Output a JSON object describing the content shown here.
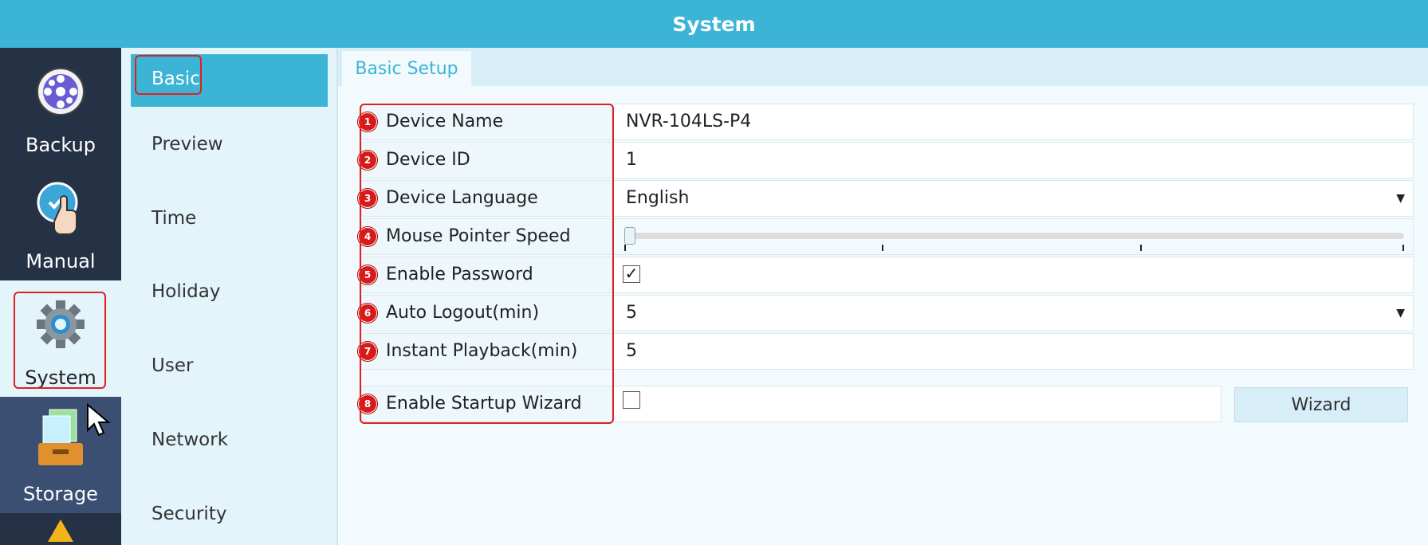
{
  "window": {
    "title": "System"
  },
  "modules": [
    {
      "label": "Backup",
      "icon": "film-reel-icon"
    },
    {
      "label": "Manual",
      "icon": "hand-pointer-icon"
    },
    {
      "label": "System",
      "icon": "gear-icon"
    },
    {
      "label": "Storage",
      "icon": "folder-stack-icon"
    },
    {
      "label": "",
      "icon": "alarm-warning-icon"
    }
  ],
  "submenu": {
    "items": [
      {
        "label": "Basic"
      },
      {
        "label": "Preview"
      },
      {
        "label": "Time"
      },
      {
        "label": "Holiday"
      },
      {
        "label": "User"
      },
      {
        "label": "Network"
      },
      {
        "label": "Security"
      }
    ]
  },
  "tabs": [
    {
      "label": "Basic Setup"
    }
  ],
  "form": {
    "device_name": {
      "badge": "1",
      "label": "Device Name",
      "value": "NVR-104LS-P4"
    },
    "device_id": {
      "badge": "2",
      "label": "Device ID",
      "value": "1"
    },
    "device_language": {
      "badge": "3",
      "label": "Device Language",
      "value": "English"
    },
    "mouse_speed": {
      "badge": "4",
      "label": "Mouse Pointer Speed",
      "level": 0
    },
    "enable_password": {
      "badge": "5",
      "label": "Enable Password",
      "checked": true,
      "check_glyph": "✓"
    },
    "auto_logout": {
      "badge": "6",
      "label": "Auto Logout(min)",
      "value": "5"
    },
    "instant_playback": {
      "badge": "7",
      "label": "Instant Playback(min)",
      "value": "5"
    },
    "startup_wizard": {
      "badge": "8",
      "label": "Enable Startup Wizard",
      "checked": false,
      "button": "Wizard"
    }
  },
  "colors": {
    "header": "#3bb4d6",
    "sidebar": "#1d2838",
    "highlight": "#e02020"
  }
}
